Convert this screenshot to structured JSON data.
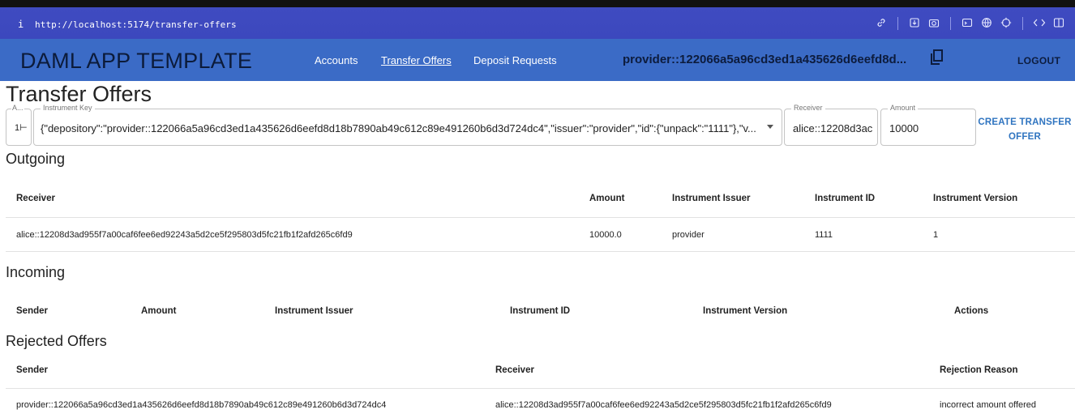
{
  "browser": {
    "info_glyph": "i",
    "url": "http://localhost:5174/transfer-offers"
  },
  "appbar": {
    "brand": "DAML APP TEMPLATE",
    "nav": [
      "Accounts",
      "Transfer Offers",
      "Deposit Requests"
    ],
    "active_nav": "Transfer Offers",
    "party": "provider::122066a5a96cd3ed1a435626d6eefd8d...",
    "logout": "LOGOUT"
  },
  "page_title": "Transfer Offers",
  "form": {
    "account_label": "A...",
    "account_value": "1⊢",
    "instrument_label": "Instrument Key",
    "instrument_value": "{\"depository\":\"provider::122066a5a96cd3ed1a435626d6eefd8d18b7890ab49c612c89e491260b6d3d724dc4\",\"issuer\":\"provider\",\"id\":{\"unpack\":\"1111\"},\"v...",
    "receiver_label": "Receiver",
    "receiver_value": "alice::12208d3ac",
    "amount_label": "Amount",
    "amount_value": "10000",
    "create_label": "CREATE TRANSFER OFFER"
  },
  "outgoing": {
    "title": "Outgoing",
    "headers": [
      "Receiver",
      "Amount",
      "Instrument Issuer",
      "Instrument ID",
      "Instrument Version"
    ],
    "rows": [
      [
        "alice::12208d3ad955f7a00caf6fee6ed92243a5d2ce5f295803d5fc21fb1f2afd265c6fd9",
        "10000.0",
        "provider",
        "1111",
        "1"
      ]
    ]
  },
  "incoming": {
    "title": "Incoming",
    "headers": [
      "Sender",
      "Amount",
      "Instrument Issuer",
      "Instrument ID",
      "Instrument Version",
      "Actions"
    ]
  },
  "rejected": {
    "title": "Rejected Offers",
    "headers": [
      "Sender",
      "Receiver",
      "Rejection Reason"
    ],
    "rows": [
      [
        "provider::122066a5a96cd3ed1a435626d6eefd8d18b7890ab49c612c89e491260b6d3d724dc4",
        "alice::12208d3ad955f7a00caf6fee6ed92243a5d2ce5f295803d5fc21fb1f2afd265c6fd9",
        "incorrect amount offered"
      ]
    ]
  },
  "icons": [
    "link-icon",
    "download-icon",
    "camera-icon",
    "terminal-icon",
    "globe-icon",
    "crosshair-icon",
    "code-icon",
    "sidebar-icon",
    "copy-icon",
    "dropdown-arrow-icon"
  ]
}
